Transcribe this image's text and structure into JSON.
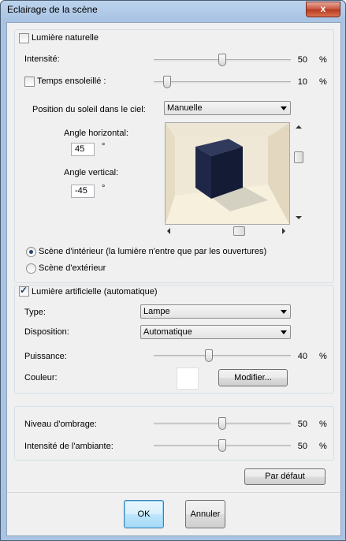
{
  "window": {
    "title": "Eclairage de la scène",
    "close_glyph": "x"
  },
  "natural": {
    "checkbox_label": "Lumière naturelle",
    "checked": false,
    "intensity_label": "Intensité:",
    "intensity_value": "50",
    "intensity_fraction": 0.5,
    "sunny_label": "Temps ensoleillé :",
    "sunny_checked": false,
    "sunny_value": "10",
    "sunny_fraction": 0.1,
    "sun_position_label": "Position du soleil dans le ciel:",
    "sun_position_value": "Manuelle",
    "h_angle_label": "Angle horizontal:",
    "h_angle_value": "45",
    "v_angle_label": "Angle vertical:",
    "v_angle_value": "-45",
    "degree_symbol": "°",
    "interior_label": "Scène d'intérieur (la lumière n'entre que par les ouvertures)",
    "exterior_label": "Scène d'extérieur",
    "scene_selected": "interior"
  },
  "artificial": {
    "checkbox_label": "Lumière artificielle (automatique)",
    "checked": true,
    "type_label": "Type:",
    "type_value": "Lampe",
    "layout_label": "Disposition:",
    "layout_value": "Automatique",
    "power_label": "Puissance:",
    "power_value": "40",
    "power_fraction": 0.4,
    "color_label": "Couleur:",
    "color_value": "#ffffff",
    "modify_label": "Modifier..."
  },
  "shading": {
    "shade_label": "Niveau d'ombrage:",
    "shade_value": "50",
    "shade_fraction": 0.5,
    "ambient_label": "Intensité de l'ambiante:",
    "ambient_value": "50",
    "ambient_fraction": 0.5
  },
  "percent_sign": "%",
  "buttons": {
    "default_label": "Par défaut",
    "ok_label": "OK",
    "cancel_label": "Annuler"
  }
}
